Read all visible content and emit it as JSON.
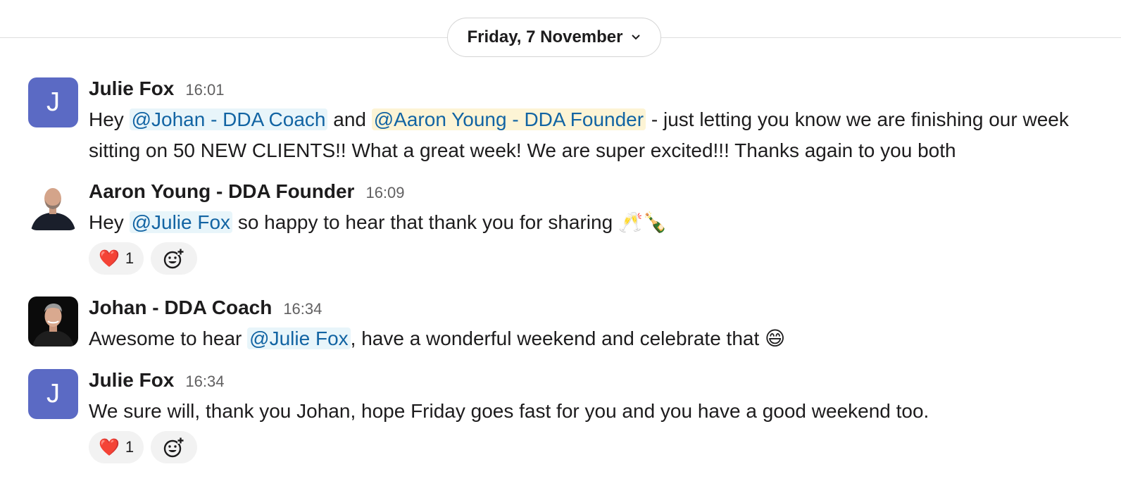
{
  "date_divider": {
    "label": "Friday, 7 November",
    "icon": "chevron-down-icon"
  },
  "messages": [
    {
      "author": "Julie Fox",
      "time": "16:01",
      "avatar_letter": "J",
      "parts": {
        "p1": "Hey ",
        "m1": "@Johan - DDA Coach",
        "p2": " and ",
        "m2": "@Aaron Young - DDA Founder",
        "p3": " - just letting you know we are finishing our week sitting on 50 NEW CLIENTS!!  What a great week!  We are super excited!!! Thanks again to you both"
      }
    },
    {
      "author": "Aaron Young - DDA Founder",
      "time": "16:09",
      "parts": {
        "p1": "Hey ",
        "m1": "@Julie Fox",
        "p2": " so happy to hear that thank you for sharing ",
        "emoji1": "🥂",
        "emoji2": "🍾"
      },
      "reaction": {
        "emoji": "❤️",
        "count": "1"
      }
    },
    {
      "author": "Johan - DDA Coach",
      "time": "16:34",
      "parts": {
        "p1": "Awesome to hear ",
        "m1": "@Julie Fox",
        "p2": ", have a wonderful weekend and celebrate that ",
        "emoji1": "😄"
      }
    },
    {
      "author": "Julie Fox",
      "time": "16:34",
      "avatar_letter": "J",
      "parts": {
        "p1": "We sure will, thank you Johan, hope Friday goes fast for you and you have a good weekend too."
      },
      "reaction": {
        "emoji": "❤️",
        "count": "1"
      }
    }
  ],
  "colors": {
    "accent_link": "#1264a3",
    "mention_bg": "#e8f5fa",
    "self_mention_bg": "#fdf4d5",
    "avatar_bg": "#5b6ac4"
  }
}
